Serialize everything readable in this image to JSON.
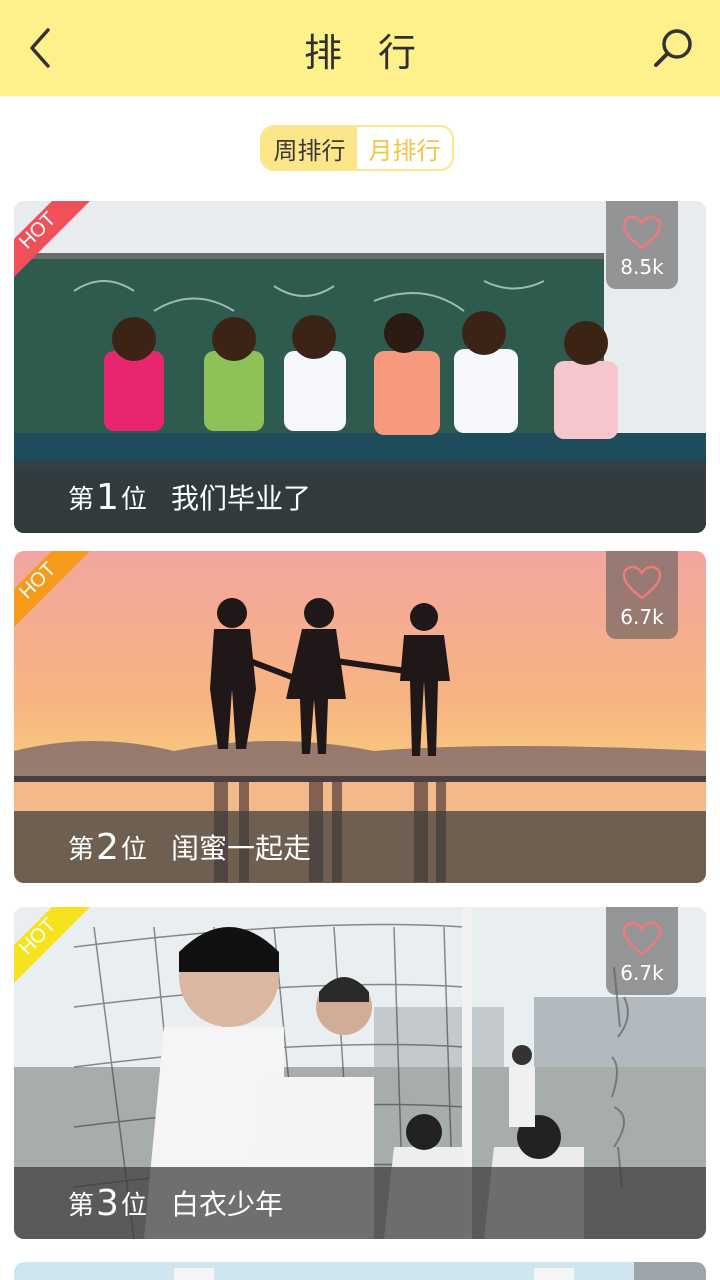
{
  "header": {
    "title": "排 行"
  },
  "tabs": {
    "weekly": "周排行",
    "monthly": "月排行"
  },
  "hot_label": "HOT",
  "items": [
    {
      "rank_prefix": "第",
      "rank": "1",
      "rank_suffix": "位",
      "title": "我们毕业了",
      "likes": "8.5k",
      "hot_color": "#f0505a"
    },
    {
      "rank_prefix": "第",
      "rank": "2",
      "rank_suffix": "位",
      "title": "闺蜜一起走",
      "likes": "6.7k",
      "hot_color": "#f59a1b"
    },
    {
      "rank_prefix": "第",
      "rank": "3",
      "rank_suffix": "位",
      "title": "白衣少年",
      "likes": "6.7k",
      "hot_color": "#f7e21e"
    }
  ],
  "icons": {
    "back": "chevron-left-icon",
    "search": "search-icon",
    "like": "heart-outline-icon"
  },
  "colors": {
    "header_bg": "#fef08a",
    "tab_active_bg": "#fde68a",
    "tab_inactive_text": "#f4c542",
    "heart": "#f07a7a"
  }
}
